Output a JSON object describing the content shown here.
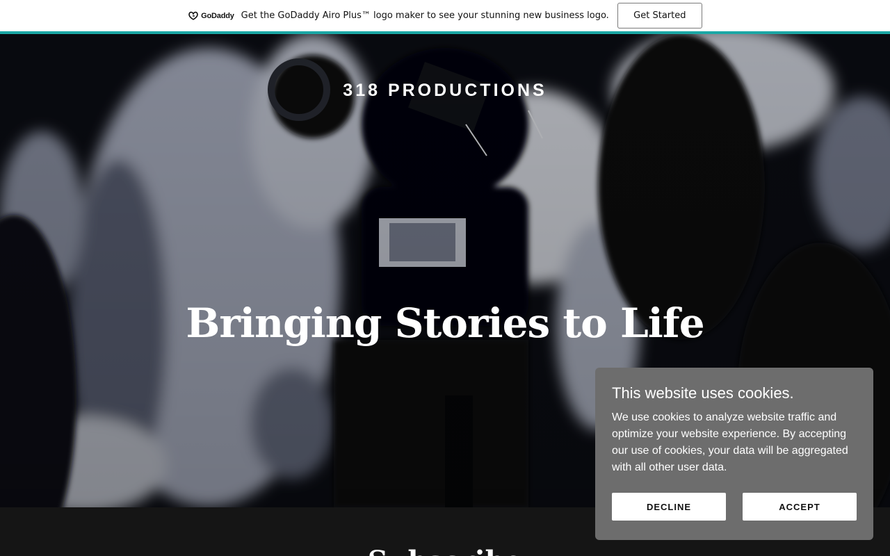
{
  "promo": {
    "logo_text": "GoDaddy",
    "message": "Get the GoDaddy Airo Plus™ logo maker to see your stunning new business logo.",
    "cta_label": "Get Started",
    "accent_color": "#1ba7a5"
  },
  "hero": {
    "brand": "318 PRODUCTIONS",
    "headline": "Bringing Stories to Life"
  },
  "section": {
    "title": "Subscribe"
  },
  "cookie_banner": {
    "title": "This website uses cookies.",
    "body": "We use cookies to analyze website traffic and optimize your website experience. By accepting our use of cookies, your data will be aggregated with all other user data.",
    "decline_label": "DECLINE",
    "accept_label": "ACCEPT",
    "background_color": "#6d6d6d"
  },
  "icons": {
    "promo_logo": "godaddy-logo-icon"
  }
}
